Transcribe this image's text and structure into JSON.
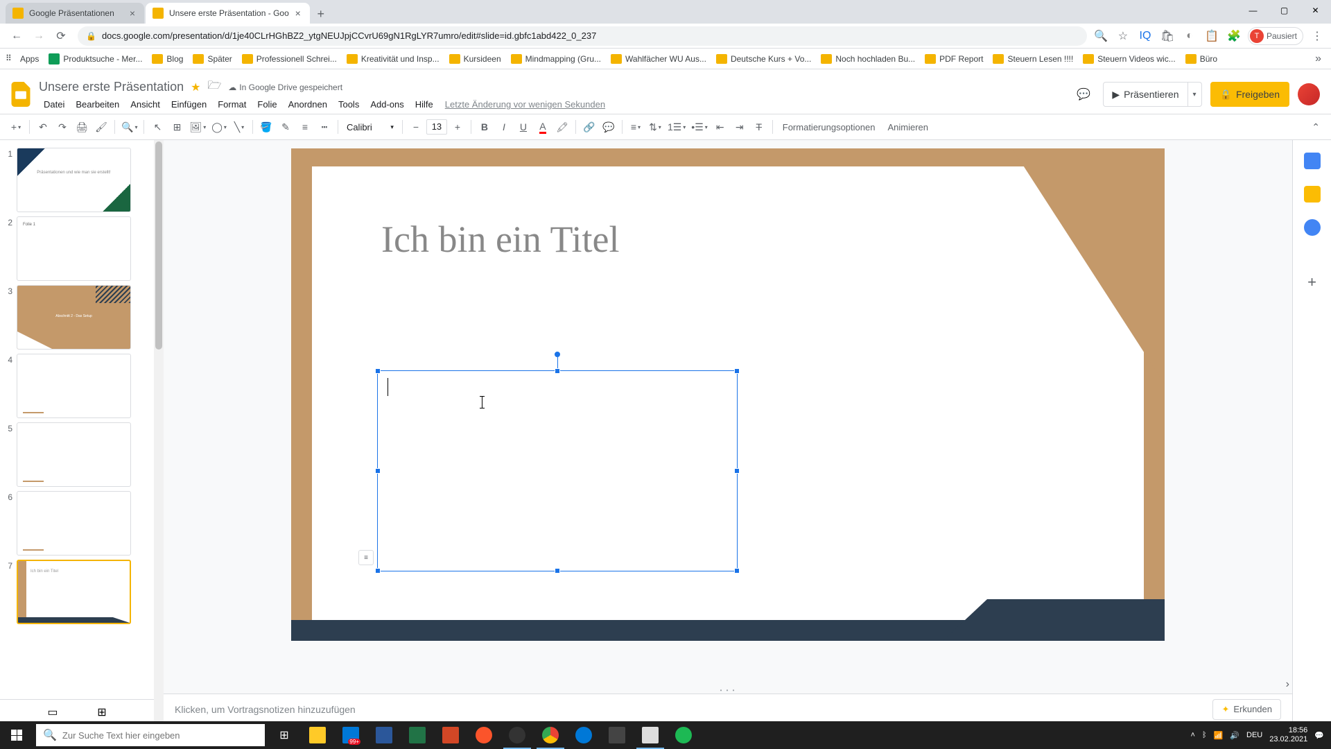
{
  "browser": {
    "tabs": [
      {
        "title": "Google Präsentationen",
        "active": false
      },
      {
        "title": "Unsere erste Präsentation - Goo",
        "active": true
      }
    ],
    "url": "docs.google.com/presentation/d/1je40CLrHGhBZ2_ytgNEUJpjCCvrU69gN1RgLYR7umro/edit#slide=id.gbfc1abd422_0_237",
    "profile_label": "Pausiert",
    "bookmarks": [
      "Apps",
      "Produktsuche - Mer...",
      "Blog",
      "Später",
      "Professionell Schrei...",
      "Kreativität und Insp...",
      "Kursideen",
      "Mindmapping  (Gru...",
      "Wahlfächer WU Aus...",
      "Deutsche Kurs + Vo...",
      "Noch hochladen Bu...",
      "PDF Report",
      "Steuern Lesen !!!!",
      "Steuern Videos wic...",
      "Büro"
    ]
  },
  "doc": {
    "title": "Unsere erste Präsentation",
    "save_status": "In Google Drive gespeichert",
    "last_change": "Letzte Änderung vor wenigen Sekunden",
    "menus": [
      "Datei",
      "Bearbeiten",
      "Ansicht",
      "Einfügen",
      "Format",
      "Folie",
      "Anordnen",
      "Tools",
      "Add-ons",
      "Hilfe"
    ],
    "present_label": "Präsentieren",
    "share_label": "Freigeben"
  },
  "toolbar": {
    "font": "Calibri",
    "font_size": "13",
    "format_options": "Formatierungsoptionen",
    "animate": "Animieren"
  },
  "thumbnails": {
    "count": 7,
    "selected": 7,
    "slide1_text": "Präsentationen und wie\nman sie erstellt!",
    "slide2_title": "Folie 1",
    "slide3_title": "Abschnitt 2 - Das Setup",
    "slide7_title": "Ich bin ein Titel"
  },
  "slide": {
    "title": "Ich bin ein Titel"
  },
  "notes": {
    "placeholder": "Klicken, um Vortragsnotizen hinzuzufügen"
  },
  "explore": {
    "label": "Erkunden"
  },
  "taskbar": {
    "search_placeholder": "Zur Suche Text hier eingeben",
    "lang": "DEU",
    "time": "18:56",
    "date": "23.02.2021",
    "badge": "99+"
  }
}
